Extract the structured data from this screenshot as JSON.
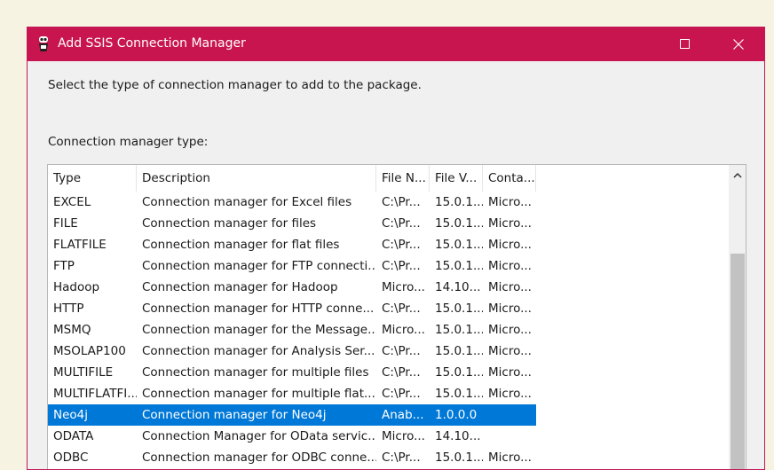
{
  "window": {
    "title": "Add SSIS Connection Manager",
    "icon": "ssis-app-icon",
    "controls": [
      "maximize-icon",
      "close-icon"
    ]
  },
  "instructions": "Select the type of connection manager to add to the package.",
  "list_label": "Connection manager type:",
  "columns": [
    "Type",
    "Description",
    "File N...",
    "File V...",
    "Conta..."
  ],
  "rows": [
    {
      "type": "EXCEL",
      "description": "Connection manager for Excel files",
      "file_name": "C:\\Pr...",
      "file_version": "15.0.1...",
      "contact": "Micro..."
    },
    {
      "type": "FILE",
      "description": "Connection manager for files",
      "file_name": "C:\\Pr...",
      "file_version": "15.0.1...",
      "contact": "Micro..."
    },
    {
      "type": "FLATFILE",
      "description": "Connection manager for flat files",
      "file_name": "C:\\Pr...",
      "file_version": "15.0.1...",
      "contact": "Micro..."
    },
    {
      "type": "FTP",
      "description": "Connection manager for FTP connecti...",
      "file_name": "C:\\Pr...",
      "file_version": "15.0.1...",
      "contact": "Micro..."
    },
    {
      "type": "Hadoop",
      "description": "Connection manager for Hadoop",
      "file_name": "Micro...",
      "file_version": "14.10...",
      "contact": "Micro..."
    },
    {
      "type": "HTTP",
      "description": "Connection manager for HTTP conne...",
      "file_name": "C:\\Pr...",
      "file_version": "15.0.1...",
      "contact": "Micro..."
    },
    {
      "type": "MSMQ",
      "description": "Connection manager for the Message...",
      "file_name": "Micro...",
      "file_version": "15.0.1...",
      "contact": "Micro..."
    },
    {
      "type": "MSOLAP100",
      "description": "Connection manager for Analysis Ser...",
      "file_name": "C:\\Pr...",
      "file_version": "15.0.1...",
      "contact": "Micro..."
    },
    {
      "type": "MULTIFILE",
      "description": "Connection manager for multiple files",
      "file_name": "C:\\Pr...",
      "file_version": "15.0.1...",
      "contact": "Micro..."
    },
    {
      "type": "MULTIFLATFI...",
      "description": "Connection manager for multiple flat...",
      "file_name": "C:\\Pr...",
      "file_version": "15.0.1...",
      "contact": "Micro..."
    },
    {
      "type": "Neo4j",
      "description": "Connection manager for Neo4j",
      "file_name": "Anab...",
      "file_version": "1.0.0.0",
      "contact": "",
      "selected": true
    },
    {
      "type": "ODATA",
      "description": "Connection Manager for OData servic...",
      "file_name": "Micro...",
      "file_version": "14.10...",
      "contact": ""
    },
    {
      "type": "ODBC",
      "description": "Connection manager for ODBC conne...",
      "file_name": "C:\\Pr...",
      "file_version": "15.0.1...",
      "contact": "Micro..."
    }
  ],
  "colors": {
    "titlebar": "#c8144f",
    "selection": "#0078d7",
    "dialog_bg": "#f0f0f0",
    "desktop_bg": "#f7f3e3"
  }
}
